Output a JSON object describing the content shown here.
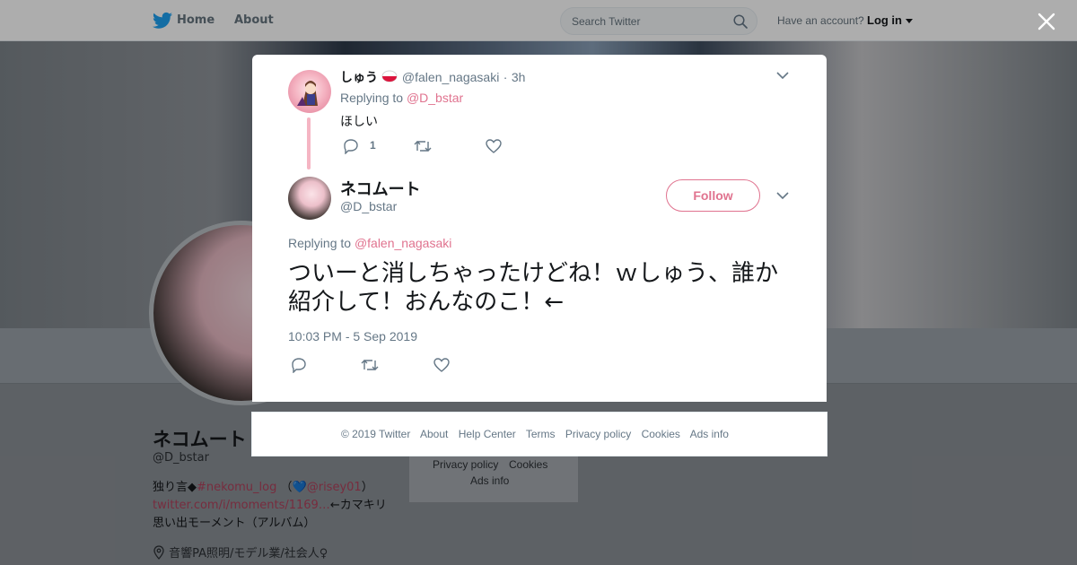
{
  "nav": {
    "home": "Home",
    "about": "About",
    "search_placeholder": "Search Twitter",
    "have_account": "Have an account?",
    "login": "Log in"
  },
  "background_profile": {
    "name": "ネコムート",
    "handle": "@D_bstar",
    "bio_line1_prefix": "独り言◆",
    "bio_hashtag": "#nekomu_log",
    "bio_paren_open": "（",
    "bio_heart": "💙",
    "bio_mention": "@risey01",
    "bio_paren_close": "）",
    "bio_link": "twitter.com/i/moments/1169…",
    "bio_link_suffix": "←カマキリ",
    "bio_line3": "思い出モーメント（アルバム）",
    "location": "音響PA照明/モデル業/社会人♀",
    "footer_card": [
      "Privacy policy",
      "Cookies",
      "Ads info"
    ]
  },
  "reply_tweet": {
    "name": "しゅう",
    "handle": "@falen_nagasaki",
    "separator": "·",
    "time": "3h",
    "replying_to_label": "Replying to",
    "replying_to_user": "@D_bstar",
    "text": "ほしい",
    "reply_count": "1"
  },
  "main_tweet": {
    "name": "ネコムート",
    "handle": "@D_bstar",
    "follow_label": "Follow",
    "replying_to_label": "Replying to",
    "replying_to_user": "@falen_nagasaki",
    "text": "ついーと消しちゃったけどね！ｗしゅう、誰か紹介して！おんなのこ！←",
    "timestamp": "10:03 PM - 5 Sep 2019"
  },
  "footer": {
    "links": [
      "© 2019 Twitter",
      "About",
      "Help Center",
      "Terms",
      "Privacy policy",
      "Cookies",
      "Ads info"
    ]
  },
  "colors": {
    "accent_pink": "#e0738f",
    "twitter_blue": "#1da1f2",
    "muted_text": "#657786"
  },
  "icons": [
    "twitter-bird-icon",
    "search-icon",
    "caret-down-icon",
    "close-icon",
    "reply-icon",
    "retweet-icon",
    "like-icon",
    "location-pin-icon"
  ]
}
